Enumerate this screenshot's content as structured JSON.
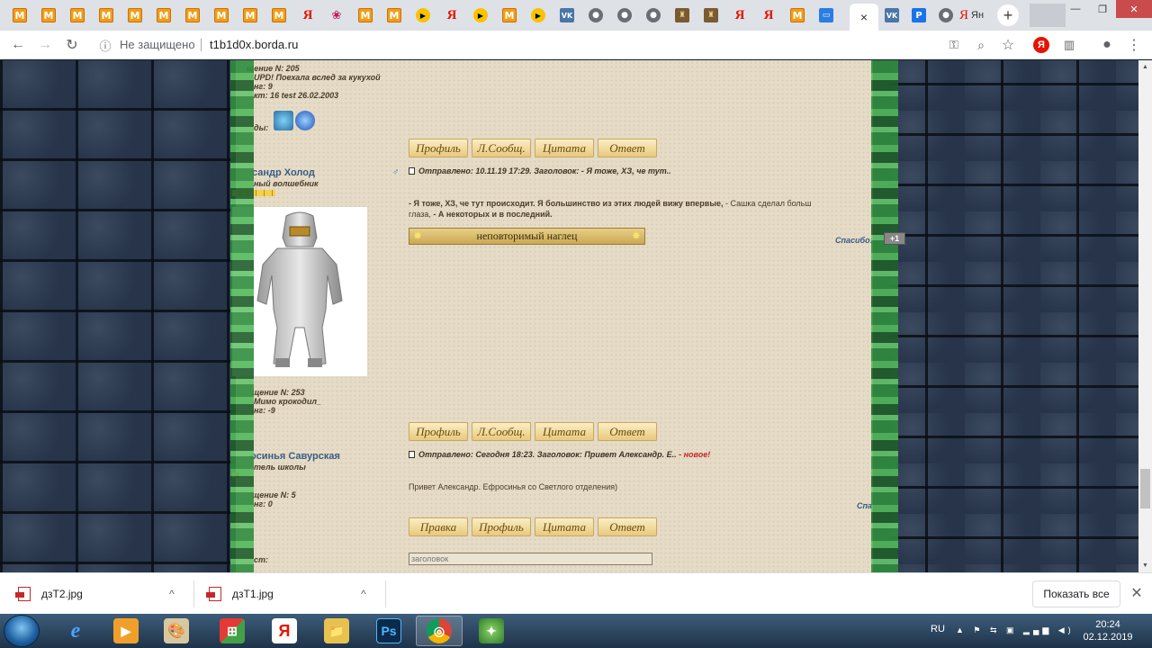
{
  "browser": {
    "tabs_fav": [
      "M",
      "M",
      "M",
      "M",
      "M",
      "M",
      "M",
      "M",
      "M",
      "M",
      "Я",
      "❀",
      "M",
      "M",
      "▶",
      "Я",
      "▶",
      "M",
      "▶",
      "VK",
      "●",
      "●",
      "●",
      "♜",
      "♜",
      "Я",
      "Я",
      "M",
      "▭"
    ],
    "active_tab_close": "×",
    "after_active": [
      "VK",
      "Р",
      "●"
    ],
    "last_tab_label": "Ян",
    "new_tab": "+",
    "window_min": "—",
    "window_max": "❐",
    "window_close": "✕",
    "security_label": "Не защищено",
    "url": "t1b1d0x.borda.ru",
    "ext_ya": "Я"
  },
  "forum": {
    "post1_info": {
      "line1": "щение N: 205",
      "line2": "UPD! Поехала вслед за кукухой",
      "line3": "нг: 9",
      "line4": "кт: 16 test 26.02.2003",
      "awards_label": "ды:"
    },
    "buttons_row1": [
      "Профиль",
      "Л.Сообщ.",
      "Цитата",
      "Ответ"
    ],
    "user2": {
      "name": "сандр Холод",
      "title": "ный волшебник",
      "gender_icon": "♂",
      "info1": "щение N: 253",
      "info2": "Мимо крокодил_",
      "info3": "нг: -9"
    },
    "post2": {
      "header": "Отправлено: 10.11.19 17:29. Заголовок: - Я тоже, ХЗ, че тут..",
      "body_bold1": "- Я тоже, ХЗ, че тут происходит. Я большинство из этих людей вижу впервые,",
      "body_normal1": " - Сашка сделал больш",
      "body_line2_normal": "глаза, ",
      "body_line2_bold": "- А некоторых и в последний.",
      "banner": "неповторимый наглец",
      "thanks": "Спасибо:",
      "plus": "+1"
    },
    "buttons_row2": [
      "Профиль",
      "Л.Сообщ.",
      "Цитата",
      "Ответ"
    ],
    "user3": {
      "name": "осинья Савурская",
      "title": "тель школы",
      "info1": "щение N: 5",
      "info2": "нг: 0"
    },
    "post3": {
      "header": "Отправлено: Сегодня 18:23. Заголовок: Привет Александр. Е.. ",
      "new_label": "- новое!",
      "body": "Привет Александр. Ефросинья со Светлого отделения)",
      "thanks": "Спа"
    },
    "buttons_row3": [
      "Правка",
      "Профиль",
      "Цитата",
      "Ответ"
    ],
    "title_placeholder": "заголовок",
    "reply_label": "ст:",
    "dots": "◦◦◦"
  },
  "downloads": {
    "items": [
      "дзТ2.jpg",
      "дзТ1.jpg"
    ],
    "chevron": "^",
    "show_all": "Показать все",
    "close": "✕"
  },
  "taskbar": {
    "apps": [
      "e",
      "▶",
      "🎨",
      "⊞",
      "Я",
      "📁",
      "Ps",
      "◎",
      "✦"
    ],
    "lang": "RU",
    "tray_icons": "▲ ⚑ ⇆ ▣ ▂▄▆ ◀)",
    "time": "20:24",
    "date": "02.12.2019"
  }
}
